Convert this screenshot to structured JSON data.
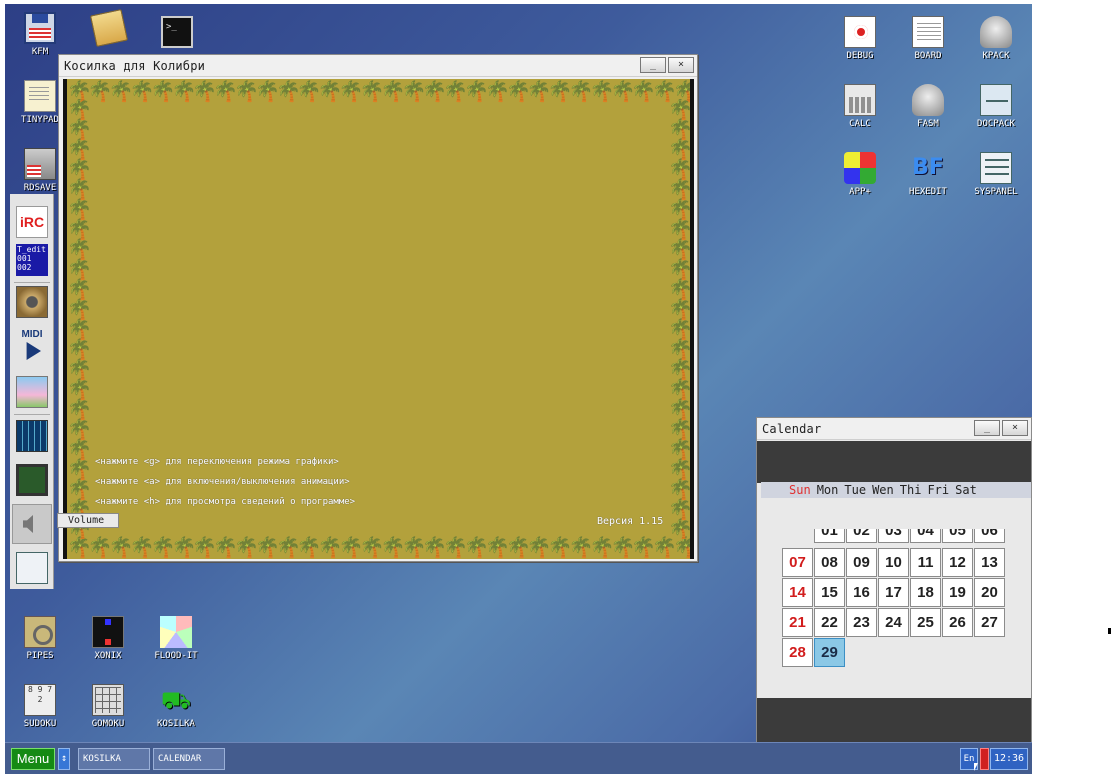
{
  "desktop": {
    "left_icons": [
      {
        "label": "KFM",
        "icon": "floppy-icon"
      },
      {
        "label": "",
        "icon": "folder-icon"
      },
      {
        "label": "",
        "icon": "terminal-icon"
      },
      {
        "label": "TINYPAD",
        "icon": "notepad-icon"
      },
      {
        "label": "RDSAVE",
        "icon": "rdsave-icon"
      }
    ],
    "right_icons": [
      {
        "label": "DEBUG",
        "icon": "debug-icon"
      },
      {
        "label": "BOARD",
        "icon": "board-icon"
      },
      {
        "label": "KPACK",
        "icon": "kpack-icon"
      },
      {
        "label": "CALC",
        "icon": "calc-icon"
      },
      {
        "label": "FASM",
        "icon": "fasm-icon"
      },
      {
        "label": "DOCPACK",
        "icon": "docpack-icon"
      },
      {
        "label": "APP+",
        "icon": "app-plus-icon"
      },
      {
        "label": "HEXEDIT",
        "icon": "hexedit-icon",
        "glyph": "BF"
      },
      {
        "label": "SYSPANEL",
        "icon": "syspanel-icon"
      }
    ],
    "bottom_icons": [
      {
        "label": "PIPES",
        "icon": "pipes-icon"
      },
      {
        "label": "XONIX",
        "icon": "xonix-icon"
      },
      {
        "label": "FLOOD-IT",
        "icon": "flood-it-icon"
      },
      {
        "label": "SUDOKU",
        "icon": "sudoku-icon",
        "glyph": "8 9 7 2"
      },
      {
        "label": "GOMOKU",
        "icon": "gomoku-icon"
      },
      {
        "label": "KOSILKA",
        "icon": "lawnmower-icon"
      }
    ]
  },
  "dock": {
    "items": [
      {
        "icon": "irc-icon"
      },
      {
        "icon": "t-edit-icon"
      },
      {
        "icon": "speaker-icon"
      },
      {
        "icon": "midi-player-icon"
      },
      {
        "icon": "image-viewer-icon"
      },
      {
        "icon": "grid-game-icon"
      },
      {
        "icon": "cpu-icon"
      },
      {
        "icon": "volume-icon"
      },
      {
        "icon": "settings-sliders-icon"
      }
    ],
    "irc_text": "iRC",
    "tedit_text": "T_edit\n001\n002",
    "midi_text": "MIDI",
    "volume_tooltip": "Volume"
  },
  "kosilka_window": {
    "title": "Косилка для Колибри",
    "minimize_label": "_",
    "close_label": "×",
    "tree_glyph": "🌴",
    "hints": [
      "<нажмите <g> для переключения режима графики>",
      "<нажмите <a> для включения/выключения анимации>",
      "<нажмите <h> для просмотра сведений о программе>"
    ],
    "version": "Версия 1.15",
    "colors": {
      "grass": "#b3a13c",
      "tree": "#2f6e21",
      "border": "#111111"
    }
  },
  "calendar_window": {
    "title": "Calendar",
    "minimize_label": "_",
    "close_label": "×",
    "day_names": [
      "Sun",
      "Mon",
      "Tue",
      "Wen",
      "Thi",
      "Fri",
      "Sat"
    ],
    "partial_row": [
      "01",
      "02",
      "03",
      "04",
      "05",
      "06"
    ],
    "weeks": [
      [
        "07",
        "08",
        "09",
        "10",
        "11",
        "12",
        "13"
      ],
      [
        "14",
        "15",
        "16",
        "17",
        "18",
        "19",
        "20"
      ],
      [
        "21",
        "22",
        "23",
        "24",
        "25",
        "26",
        "27"
      ],
      [
        "28",
        "29"
      ]
    ],
    "today": "29",
    "colors": {
      "sunday": "#d21d1d",
      "today": "#8bc8e6"
    }
  },
  "taskbar": {
    "menu_label": "Menu",
    "toggle_label": "↕",
    "tasks": [
      "KOSILKA",
      "CALENDAR"
    ],
    "language": "En",
    "clock": "12:36",
    "colors": {
      "menu": "#158a14",
      "bar": "#445c8e"
    }
  }
}
